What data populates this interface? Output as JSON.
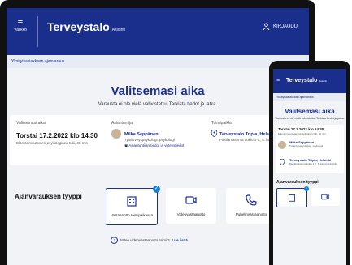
{
  "header": {
    "menu_label": "Valikko",
    "brand": "Terveystalo",
    "brand_sub": "Asiointi",
    "login_label": "KIRJAUDU"
  },
  "breadcrumb": "Yksityisasiakkaan ajanvaraus",
  "page_title": "Valitsemasi aika",
  "subtitle": "Varausta ei ole vielä vahvistettu. Tarkista tiedot ja jatka.",
  "summary": {
    "time_heading": "Valitsemasi aika",
    "datetime": "Torstai 17.2.2022 klo 14.30",
    "duration": "Elämänmuutosten psykologinen tuki, 60 min",
    "expert_heading": "Asiantuntija",
    "expert_name": "Milka Seppänen",
    "expert_role": "Työterveyspsykologi, psykologi",
    "expert_link": "Asiantuntijan tiedot ja yhteystiedot",
    "location_heading": "Toimipaikka",
    "location_name": "Terveystalo Tripla, Helsinki",
    "location_addr": "Pasilan asema aukio 1 C, 5. kerros, Helsinki"
  },
  "booking_type": {
    "title": "Ajanvarauksen tyyppi",
    "options": [
      {
        "label": "Vastaanotto toimipaikassa",
        "selected": true
      },
      {
        "label": "Videovastaanotto",
        "selected": false
      },
      {
        "label": "Puhelinvastaanotto",
        "selected": false
      }
    ],
    "help_text": "Miten videovastaanotto toimii?",
    "help_link": "Lue lisää"
  },
  "phone": {
    "brand": "Terveystalo",
    "brand_sub": "Asiointi",
    "breadcrumb": "Yksityisasiakkaan ajanvaraus",
    "title": "Valitsemasi aika",
    "subtitle": "Varausta ei ole vielä vahvistettu. Tarkista tiedot ja jatka.",
    "datetime": "Torstai 17.2.2022 klo 14.30",
    "duration": "Elämänmuutosten psykologinen tuki, 60 min",
    "expert_name": "Milka Seppänen",
    "expert_role": "Työterveyspsykologi, psykologi",
    "location_name": "Terveystalo Tripla, Helsinki",
    "location_addr": "Pasilan asema aukio 1 C, 5. kerros, Helsinki",
    "type_title": "Ajanvarauksen tyyppi"
  },
  "colors": {
    "primary": "#1a2f8c",
    "accent": "#1a7fd6",
    "background": "#f1f3f7"
  }
}
